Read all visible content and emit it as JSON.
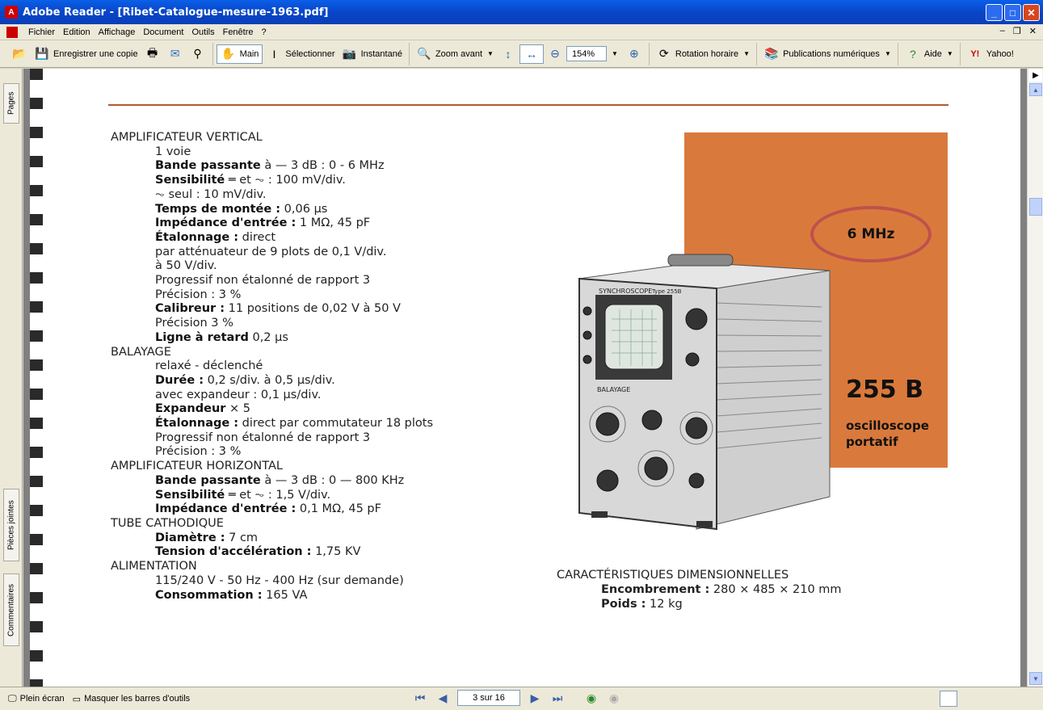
{
  "window": {
    "title": "Adobe Reader - [Ribet-Catalogue-mesure-1963.pdf]"
  },
  "menu": [
    "Fichier",
    "Edition",
    "Affichage",
    "Document",
    "Outils",
    "Fenêtre",
    "?"
  ],
  "toolbar": {
    "save_copy": "Enregistrer une copie",
    "hand": "Main",
    "select": "Sélectionner",
    "snapshot": "Instantané",
    "zoom_in": "Zoom avant",
    "zoom_value": "154%",
    "rotate": "Rotation horaire",
    "digital_editions": "Publications numériques",
    "help": "Aide",
    "yahoo": "Yahoo!"
  },
  "left_tabs": {
    "pages": "Pages",
    "attachments": "Pièces jointes",
    "comments": "Commentaires"
  },
  "document": {
    "sections": [
      {
        "kind": "hdr",
        "text": "AMPLIFICATEUR VERTICAL"
      },
      {
        "kind": "ind",
        "text": "1 voie"
      },
      {
        "kind": "ind",
        "label": "Bande passante",
        "text": " à — 3 dB : 0 - 6 MHz"
      },
      {
        "kind": "ind",
        "label": "Sensibilité",
        "text": " ═ et ⏦ : 100 mV/div."
      },
      {
        "kind": "ind",
        "text": "⏦ seul : 10 mV/div."
      },
      {
        "kind": "ind",
        "label": "Temps de montée :",
        "text": " 0,06 µs"
      },
      {
        "kind": "ind",
        "label": "Impédance d'entrée :",
        "text": " 1 MΩ, 45 pF"
      },
      {
        "kind": "ind",
        "label": "Étalonnage :",
        "text": " direct"
      },
      {
        "kind": "ind",
        "text": "par atténuateur de 9 plots de 0,1 V/div."
      },
      {
        "kind": "ind",
        "text": "à 50 V/div."
      },
      {
        "kind": "ind",
        "text": "Progressif non étalonné de rapport 3"
      },
      {
        "kind": "ind",
        "text": "Précision : 3 %"
      },
      {
        "kind": "ind",
        "label": "Calibreur :",
        "text": " 11 positions de 0,02 V à 50 V"
      },
      {
        "kind": "ind",
        "text": "Précision 3 %"
      },
      {
        "kind": "ind",
        "label": "Ligne à retard",
        "text": " 0,2 µs"
      },
      {
        "kind": "hdr",
        "text": "BALAYAGE"
      },
      {
        "kind": "ind",
        "text": "relaxé - déclenché"
      },
      {
        "kind": "ind",
        "label": "Durée :",
        "text": " 0,2 s/div. à 0,5 µs/div."
      },
      {
        "kind": "ind",
        "text": "avec expandeur : 0,1 µs/div."
      },
      {
        "kind": "ind",
        "label": "Expandeur",
        "text": " × 5"
      },
      {
        "kind": "ind",
        "label": "Étalonnage :",
        "text": " direct par commutateur 18 plots"
      },
      {
        "kind": "ind",
        "text": "Progressif non étalonné de rapport 3"
      },
      {
        "kind": "ind",
        "text": "Précision : 3 %"
      },
      {
        "kind": "hdr",
        "text": "AMPLIFICATEUR HORIZONTAL"
      },
      {
        "kind": "ind",
        "label": "Bande passante",
        "text": " à — 3 dB : 0 — 800 KHz"
      },
      {
        "kind": "ind",
        "label": "Sensibilité",
        "text": " ═ et ⏦ : 1,5 V/div."
      },
      {
        "kind": "ind",
        "label": "Impédance d'entrée :",
        "text": " 0,1 MΩ, 45 pF"
      },
      {
        "kind": "hdr",
        "text": "TUBE CATHODIQUE"
      },
      {
        "kind": "ind",
        "label": "Diamètre :",
        "text": " 7 cm"
      },
      {
        "kind": "ind",
        "label": "Tension d'accélération :",
        "text": " 1,75 KV"
      },
      {
        "kind": "hdr",
        "text": "ALIMENTATION"
      },
      {
        "kind": "ind",
        "text": "115/240 V - 50 Hz - 400 Hz (sur demande)"
      },
      {
        "kind": "ind",
        "label": "Consommation :",
        "text": " 165 VA"
      }
    ],
    "badge": "6 MHz",
    "model": "255 B",
    "model_desc_1": "oscilloscope",
    "model_desc_2": "portatif",
    "dims_title": "CARACTÉRISTIQUES DIMENSIONNELLES",
    "dims_1_label": "Encombrement :",
    "dims_1_value": " 280 × 485 × 210 mm",
    "dims_2_label": "Poids :",
    "dims_2_value": " 12 kg",
    "scope_panel_text": "SYNCHROSCOPE",
    "scope_model_text": "Type 255B",
    "scope_sweep_text": "BALAYAGE",
    "colors": {
      "panel": "#d97a3c",
      "ring": "#c0504d",
      "rule": "#b35a2a"
    }
  },
  "statusbar": {
    "fullscreen": "Plein écran",
    "hide_toolbars": "Masquer les barres d'outils",
    "page_indicator": "3 sur 16"
  }
}
